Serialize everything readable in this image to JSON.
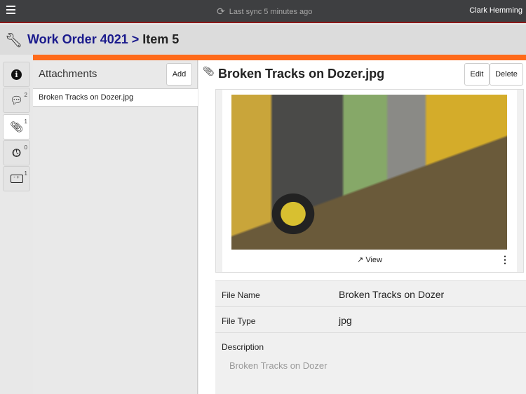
{
  "topbar": {
    "sync": "Last sync 5 minutes ago",
    "user": "Clark Hemming"
  },
  "header": {
    "work_order": "Work Order 4021",
    "sep": ">",
    "item": "Item 5"
  },
  "rail": {
    "comments_count": "2",
    "attachments_count": "1",
    "time_count": "0",
    "parts_count": "1"
  },
  "attachments": {
    "title": "Attachments",
    "add": "Add",
    "items": [
      "Broken Tracks on Dozer.jpg"
    ]
  },
  "detail": {
    "title": "Broken Tracks on Dozer.jpg",
    "edit": "Edit",
    "delete": "Delete",
    "view": "View",
    "fields": {
      "file_name_label": "File Name",
      "file_name": "Broken Tracks on Dozer",
      "file_type_label": "File Type",
      "file_type": "jpg",
      "description_label": "Description",
      "description": "Broken Tracks on Dozer"
    }
  },
  "colors": {
    "accent": "#ff6a1a",
    "link": "#1a1a8c",
    "topbar": "#3e3f41"
  }
}
